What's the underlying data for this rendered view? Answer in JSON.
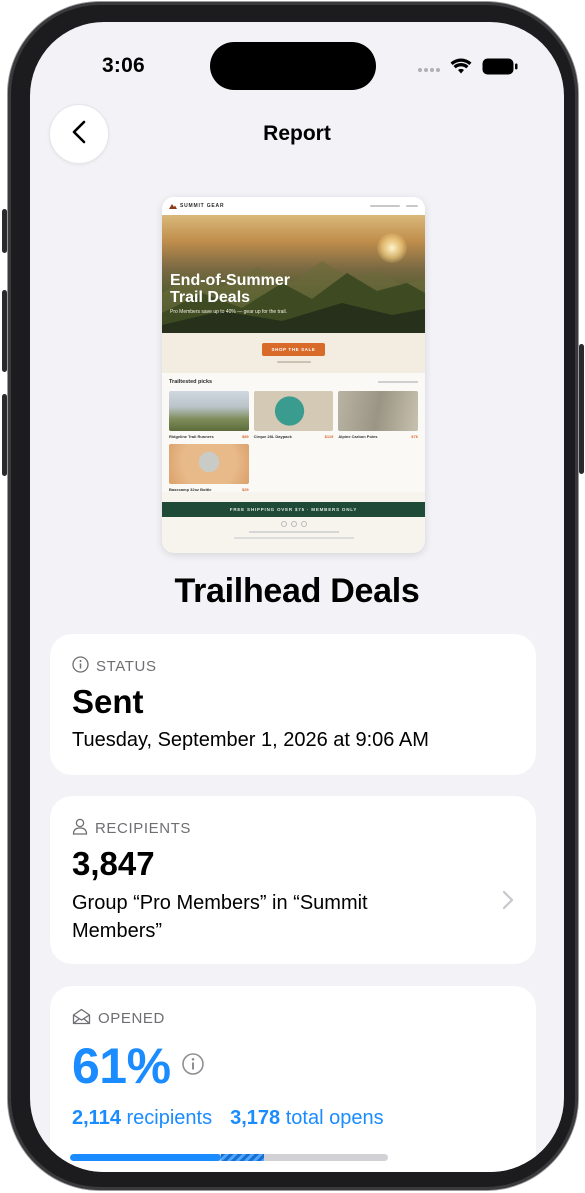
{
  "status_bar": {
    "time": "3:06"
  },
  "nav": {
    "title": "Report",
    "back_icon": "chevron-left-icon"
  },
  "email_preview": {
    "brand": "SUMMIT GEAR",
    "hero_title_line1": "End-of-Summer",
    "hero_title_line2": "Trail Deals",
    "hero_subtitle": "Pro Members save up to 40% — gear up for the trail.",
    "cta_label": "SHOP THE SALE",
    "section_title": "Trailtested picks",
    "products": [
      {
        "name": "Ridgeline Trail Runners",
        "price": "$89"
      },
      {
        "name": "Cirque 28L Daypack",
        "price": "$119"
      },
      {
        "name": "Alpine Carbon Poles",
        "price": "$76"
      },
      {
        "name": "Basecamp 32oz Bottle",
        "price": "$29"
      }
    ],
    "band_text": "FREE SHIPPING OVER $75 · MEMBERS ONLY"
  },
  "mail_title": "Trailhead Deals",
  "status_card": {
    "label": "STATUS",
    "icon": "info-circle-icon",
    "value": "Sent",
    "date": "Tuesday, September 1, 2026 at 9:06 AM"
  },
  "recipients_card": {
    "label": "RECIPIENTS",
    "icon": "person-icon",
    "count": "3,847",
    "description": "Group “Pro Members” in “Summit Members”"
  },
  "opened_card": {
    "label": "OPENED",
    "icon": "envelope-open-icon",
    "percent": "61%",
    "recipients_num": "2,114",
    "recipients_word": "recipients",
    "opens_num": "3,178",
    "opens_word": "total opens",
    "progress_fraction": 0.61
  },
  "colors": {
    "accent": "#1a8cff",
    "background": "#f2f2f7",
    "cta": "#d86a2a",
    "footer_band": "#1f4a37"
  }
}
